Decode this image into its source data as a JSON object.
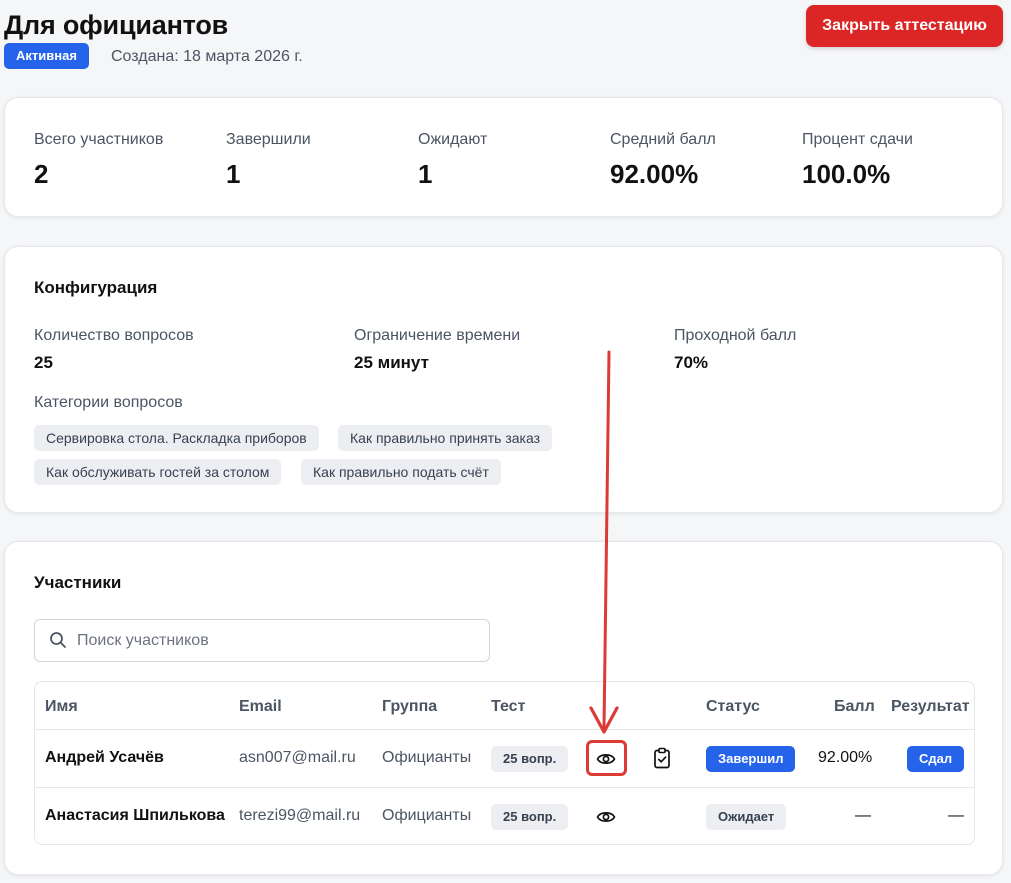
{
  "page": {
    "title": "Для официантов",
    "status": "Активная",
    "created": "Создана: 18 марта 2026 г.",
    "close_button": "Закрыть аттестацию"
  },
  "stats": [
    {
      "label": "Всего участников",
      "value": "2"
    },
    {
      "label": "Завершили",
      "value": "1"
    },
    {
      "label": "Ожидают",
      "value": "1"
    },
    {
      "label": "Средний балл",
      "value": "92.00%"
    },
    {
      "label": "Процент сдачи",
      "value": "100.0%"
    }
  ],
  "config": {
    "title": "Конфигурация",
    "items": [
      {
        "label": "Количество вопросов",
        "value": "25"
      },
      {
        "label": "Ограничение времени",
        "value": "25 минут"
      },
      {
        "label": "Проходной балл",
        "value": "70%"
      }
    ],
    "categories_label": "Категории вопросов",
    "categories": [
      "Сервировка стола. Раскладка приборов",
      "Как правильно принять заказ",
      "Как обслуживать гостей за столом",
      "Как правильно подать счёт"
    ]
  },
  "participants": {
    "title": "Участники",
    "search_placeholder": "Поиск участников",
    "columns": [
      "Имя",
      "Email",
      "Группа",
      "Тест",
      "Статус",
      "Балл",
      "Результат"
    ],
    "rows": [
      {
        "name": "Андрей Усачёв",
        "email": "asn007@mail.ru",
        "group": "Официанты",
        "test": "25 вопр.",
        "status": "Завершил",
        "score": "92.00%",
        "result": "Сдал"
      },
      {
        "name": "Анастасия Шпилькова",
        "email": "terezi99@mail.ru",
        "group": "Официанты",
        "test": "25 вопр.",
        "status": "Ожидает",
        "score": "—",
        "result": "—"
      }
    ]
  },
  "icons": {
    "search": "search-icon",
    "view": "eye-icon",
    "report": "clipboard-check-icon"
  },
  "colors": {
    "accent": "#2563eb",
    "danger": "#dc2626",
    "annotation": "#dc3a35"
  }
}
